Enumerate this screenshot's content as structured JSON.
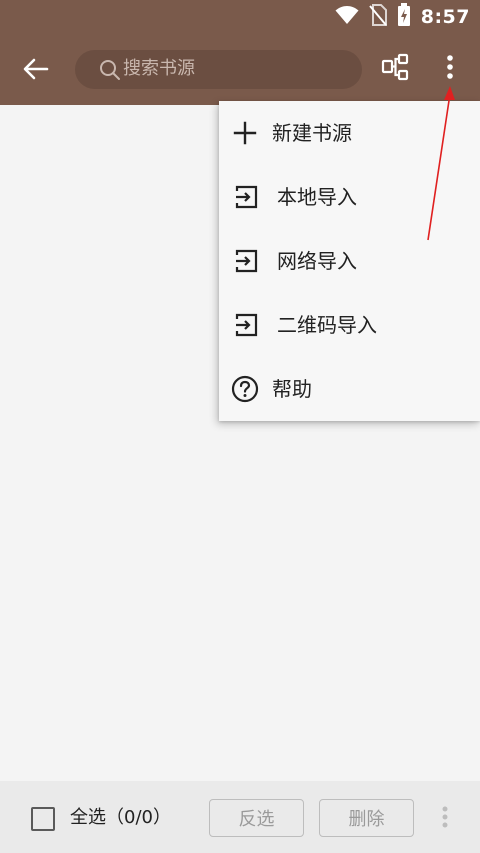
{
  "status_bar": {
    "time": "8:57",
    "icons": [
      "wifi-icon",
      "no-sim-icon",
      "battery-charging-icon"
    ]
  },
  "toolbar": {
    "back_icon": "arrow-back-icon",
    "search": {
      "placeholder": "搜索书源",
      "icon": "search-icon"
    },
    "group_icon": "source-group-icon",
    "more_icon": "more-vertical-icon"
  },
  "menu": {
    "items": [
      {
        "label": "新建书源",
        "icon": "add-icon"
      },
      {
        "label": "本地导入",
        "icon": "import-icon"
      },
      {
        "label": "网络导入",
        "icon": "import-icon"
      },
      {
        "label": "二维码导入",
        "icon": "import-icon"
      },
      {
        "label": "帮助",
        "icon": "help-circle-icon"
      }
    ]
  },
  "bottom_bar": {
    "select_all_label": "全选（0/0）",
    "invert_label": "反选",
    "delete_label": "删除",
    "more_icon": "more-vertical-icon"
  },
  "colors": {
    "toolbar": "#7a5a4b",
    "search_box": "#6b4e41",
    "annotation": "#e02020",
    "background": "#f4f4f4"
  }
}
